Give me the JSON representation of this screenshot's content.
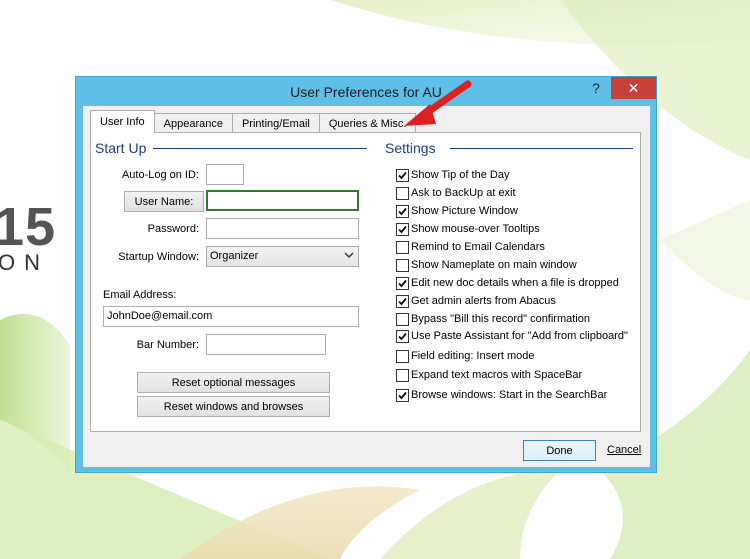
{
  "background": {
    "big_text": "15",
    "small_text": "ON"
  },
  "dialog": {
    "title": "User Preferences for AU",
    "minimize_glyph": "?",
    "close_glyph": "✕",
    "tabs": [
      "User Info",
      "Appearance",
      "Printing/Email",
      "Queries & Misc."
    ],
    "startup": {
      "heading": "Start Up",
      "auto_log_label": "Auto-Log on ID:",
      "auto_log_value": "",
      "user_name_button": "User Name:",
      "user_name_value": "",
      "password_label": "Password:",
      "password_value": "",
      "startup_window_label": "Startup Window:",
      "startup_window_value": "Organizer",
      "email_label": "Email Address:",
      "email_value": "JohnDoe@email.com",
      "bar_number_label": "Bar Number:",
      "bar_number_value": "",
      "reset_messages_button": "Reset optional messages",
      "reset_windows_button": "Reset windows and browses"
    },
    "settings": {
      "heading": "Settings",
      "items": [
        {
          "label": "Show Tip of the Day",
          "checked": true
        },
        {
          "label": "Ask to BackUp at exit",
          "checked": false
        },
        {
          "label": "Show Picture Window",
          "checked": true
        },
        {
          "label": "Show mouse-over Tooltips",
          "checked": true
        },
        {
          "label": "Remind to Email Calendars",
          "checked": false
        },
        {
          "label": "Show Nameplate on main window",
          "checked": false
        },
        {
          "label": "Edit new doc details when a file is dropped",
          "checked": true
        },
        {
          "label": "Get admin alerts from Abacus",
          "checked": true
        },
        {
          "label": "Bypass \"Bill this record\" confirmation",
          "checked": false
        },
        {
          "label": "Use Paste Assistant for \"Add from clipboard\"",
          "checked": true
        },
        {
          "label": "Field editing: Insert mode",
          "checked": false
        },
        {
          "label": "Expand text macros with SpaceBar",
          "checked": false
        },
        {
          "label": "Browse windows: Start in the SearchBar",
          "checked": true
        }
      ]
    },
    "done_button": "Done",
    "cancel_button": "Cancel"
  },
  "colors": {
    "title_bar": "#5ec0e7",
    "close_button": "#c7403a",
    "section_heading": "#1e3f73",
    "annotation_arrow": "#e02020"
  }
}
